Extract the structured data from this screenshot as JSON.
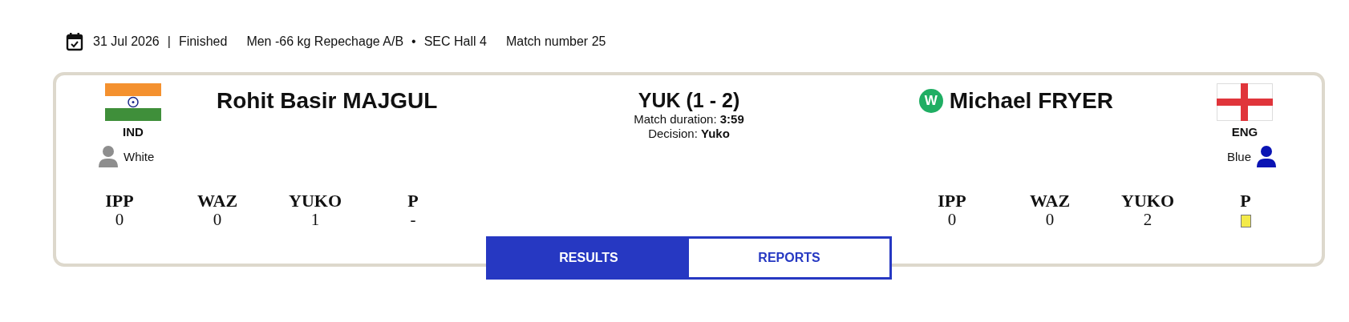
{
  "header": {
    "date": "31 Jul 2026",
    "separator": "|",
    "status": "Finished",
    "category": "Men -66 kg Repechage A/B",
    "dot": "•",
    "venue": "SEC Hall 4",
    "match": "Match number 25"
  },
  "competitors": [
    {
      "name": "Rohit Basir MAJGUL",
      "country": "IND",
      "winner": false,
      "judogi": "White",
      "color": "#8e8e8e",
      "scores": [
        {
          "label": "IPP",
          "kind": "text",
          "value": "0"
        },
        {
          "label": "WAZ",
          "kind": "text",
          "value": "0"
        },
        {
          "label": "YUKO",
          "kind": "text",
          "value": "1"
        },
        {
          "label": "P",
          "kind": "text",
          "value": "-"
        }
      ]
    },
    {
      "name": "Michael FRYER",
      "country": "ENG",
      "winner": true,
      "winner_badge": "W",
      "judogi": "Blue",
      "color": "#0a14b4",
      "scores": [
        {
          "label": "IPP",
          "kind": "text",
          "value": "0"
        },
        {
          "label": "WAZ",
          "kind": "text",
          "value": "0"
        },
        {
          "label": "YUKO",
          "kind": "text",
          "value": "2"
        },
        {
          "label": "P",
          "kind": "card"
        }
      ]
    }
  ],
  "result": {
    "title": "YUK (1 - 2)",
    "duration_label": "Match duration:",
    "duration": "3:59",
    "decision_label": "Decision:",
    "decision": "Yuko"
  },
  "tabs": [
    {
      "label": "RESULTS",
      "selected": true
    },
    {
      "label": "REPORTS",
      "selected": false
    }
  ]
}
